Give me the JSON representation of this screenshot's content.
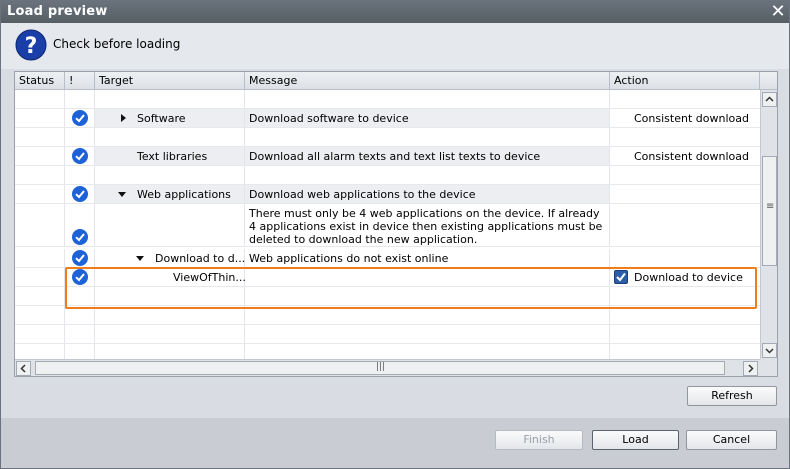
{
  "window": {
    "title": "Load preview",
    "close_glyph": "✕"
  },
  "header": {
    "icon": "question-icon",
    "text": "Check before loading"
  },
  "columns": [
    "Status",
    "!",
    "Target",
    "Message",
    "Action"
  ],
  "rows": [
    {
      "target": "Software",
      "message": "Download software to device",
      "action": "Consistent download",
      "status_icon": "check-circle-icon",
      "expander": "collapsed"
    },
    {
      "target": "Text libraries",
      "message": "Download all alarm texts and text list texts to device",
      "action": "Consistent download",
      "status_icon": "check-circle-icon"
    },
    {
      "target": "Web applications",
      "message": "Download web applications to the device",
      "action": "",
      "status_icon": "check-circle-icon",
      "expander": "expanded"
    },
    {
      "target": "",
      "message": "There must only be 4 web applications on the device. If already 4 applications exist in device then existing applications must be deleted to download the new application.",
      "action": "",
      "status_icon": "check-circle-icon"
    },
    {
      "target": "Download to d...",
      "message": "Web applications do not  exist online",
      "action": "",
      "status_icon": "check-circle-icon",
      "expander": "expanded"
    },
    {
      "target": "ViewOfThin...",
      "message": "",
      "action": "Download to device",
      "action_checked": true,
      "status_icon": "check-circle-icon"
    }
  ],
  "scroll": {
    "hthumb_grip": "|||",
    "vthumb_grip": "≡"
  },
  "buttons": {
    "refresh": "Refresh",
    "finish": "Finish",
    "load": "Load",
    "cancel": "Cancel"
  },
  "colors": {
    "highlight": "#f07c1a",
    "status_check": "#1d62d6",
    "titlebar": "#5f6870"
  }
}
